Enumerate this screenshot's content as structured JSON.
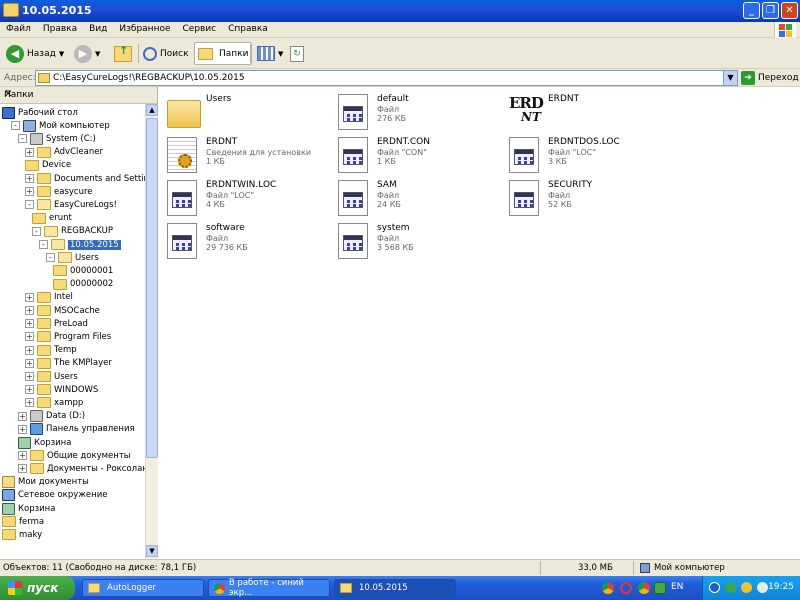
{
  "window": {
    "title": "10.05.2015"
  },
  "menu": [
    "Файл",
    "Правка",
    "Вид",
    "Избранное",
    "Сервис",
    "Справка"
  ],
  "toolbar": {
    "back": "Назад",
    "search": "Поиск",
    "folders": "Папки"
  },
  "address": {
    "label": "Адрес:",
    "path": "C:\\EasyCureLogs!\\REGBACKUP\\10.05.2015",
    "go": "Переход"
  },
  "left_panel": {
    "title": "Папки",
    "tree": [
      {
        "label": "Рабочий стол",
        "level": 0,
        "exp": "",
        "icon": "desktop"
      },
      {
        "label": "Мой компьютер",
        "level": 1,
        "exp": "-",
        "icon": "computer"
      },
      {
        "label": "System (C:)",
        "level": 2,
        "exp": "-",
        "icon": "drive"
      },
      {
        "label": "AdvCleaner",
        "level": 3,
        "exp": "+",
        "icon": "folder"
      },
      {
        "label": "Device",
        "level": 3,
        "exp": "",
        "icon": "folder"
      },
      {
        "label": "Documents and Settings",
        "level": 3,
        "exp": "+",
        "icon": "folder"
      },
      {
        "label": "easycure",
        "level": 3,
        "exp": "+",
        "icon": "folder"
      },
      {
        "label": "EasyCureLogs!",
        "level": 3,
        "exp": "-",
        "icon": "folder-open"
      },
      {
        "label": "erunt",
        "level": 4,
        "exp": "",
        "icon": "folder"
      },
      {
        "label": "REGBACKUP",
        "level": 4,
        "exp": "-",
        "icon": "folder-open"
      },
      {
        "label": "10.05.2015",
        "level": 5,
        "exp": "-",
        "icon": "folder-open"
      },
      {
        "label": "Users",
        "level": 6,
        "exp": "-",
        "icon": "folder-open"
      },
      {
        "label": "00000001",
        "level": 7,
        "exp": "",
        "icon": "folder"
      },
      {
        "label": "00000002",
        "level": 7,
        "exp": "",
        "icon": "folder"
      },
      {
        "label": "Intel",
        "level": 3,
        "exp": "+",
        "icon": "folder"
      },
      {
        "label": "MSOCache",
        "level": 3,
        "exp": "+",
        "icon": "folder"
      },
      {
        "label": "PreLoad",
        "level": 3,
        "exp": "+",
        "icon": "folder"
      },
      {
        "label": "Program Files",
        "level": 3,
        "exp": "+",
        "icon": "folder"
      },
      {
        "label": "Temp",
        "level": 3,
        "exp": "+",
        "icon": "folder"
      },
      {
        "label": "The KMPlayer",
        "level": 3,
        "exp": "+",
        "icon": "folder"
      },
      {
        "label": "Users",
        "level": 3,
        "exp": "+",
        "icon": "folder"
      },
      {
        "label": "WINDOWS",
        "level": 3,
        "exp": "+",
        "icon": "folder"
      },
      {
        "label": "xampp",
        "level": 3,
        "exp": "+",
        "icon": "folder"
      },
      {
        "label": "Data (D:)",
        "level": 2,
        "exp": "+",
        "icon": "drive"
      },
      {
        "label": "Панель управления",
        "level": 2,
        "exp": "+",
        "icon": "control"
      },
      {
        "label": "Корзина",
        "level": 2,
        "exp": "",
        "icon": "recycle"
      },
      {
        "label": "Общие документы",
        "level": 2,
        "exp": "+",
        "icon": "folder"
      },
      {
        "label": "Документы - Роксолана",
        "level": 2,
        "exp": "+",
        "icon": "folder"
      },
      {
        "label": "Мои документы",
        "level": 0,
        "exp": "",
        "icon": "mydocs"
      },
      {
        "label": "Сетевое окружение",
        "level": 0,
        "exp": "",
        "icon": "network"
      },
      {
        "label": "Корзина",
        "level": 0,
        "exp": "",
        "icon": "recycle"
      },
      {
        "label": "ferma",
        "level": 0,
        "exp": "",
        "icon": "folder"
      },
      {
        "label": "maky",
        "level": 0,
        "exp": "",
        "icon": "folder"
      }
    ]
  },
  "files": [
    {
      "name": "Users",
      "type": "",
      "size": "",
      "icon": "folder"
    },
    {
      "name": "default",
      "type": "Файл",
      "size": "276 КБ",
      "icon": "file"
    },
    {
      "name": "ERDNT",
      "type": "",
      "size": "",
      "icon": "erd-logo"
    },
    {
      "name": "ERDNT",
      "type": "Сведения для установки",
      "size": "1 КБ",
      "icon": "setup-info"
    },
    {
      "name": "ERDNT.CON",
      "type": "Файл \"CON\"",
      "size": "1 КБ",
      "icon": "file"
    },
    {
      "name": "ERDNTDOS.LOC",
      "type": "Файл \"LOC\"",
      "size": "3 КБ",
      "icon": "file"
    },
    {
      "name": "ERDNTWIN.LOC",
      "type": "Файл \"LOC\"",
      "size": "4 КБ",
      "icon": "file"
    },
    {
      "name": "SAM",
      "type": "Файл",
      "size": "24 КБ",
      "icon": "file"
    },
    {
      "name": "SECURITY",
      "type": "Файл",
      "size": "52 КБ",
      "icon": "file"
    },
    {
      "name": "software",
      "type": "Файл",
      "size": "29 736 КБ",
      "icon": "file"
    },
    {
      "name": "system",
      "type": "Файл",
      "size": "3 568 КБ",
      "icon": "file"
    }
  ],
  "erd_logo": {
    "top": "ERD",
    "bottom": "NT"
  },
  "status": {
    "objects": "Объектов: 11 (Свободно на диске: 78,1 ГБ)",
    "size": "33,0 МБ",
    "location": "Мой компьютер"
  },
  "taskbar": {
    "start": "пуск",
    "tasks": [
      "AutoLogger",
      "В работе - синий экр...",
      "10.05.2015"
    ],
    "lang": "EN",
    "time": "19:25"
  }
}
